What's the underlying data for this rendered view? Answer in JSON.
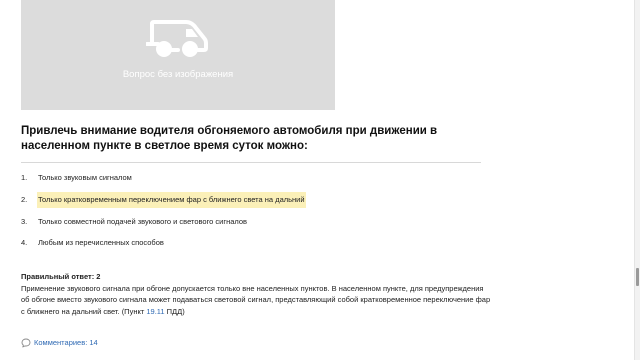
{
  "image_placeholder": {
    "icon": "car-icon",
    "text": "Вопрос без изображения"
  },
  "question": {
    "text": "Привлечь внимание водителя обгоняемого автомобиля при движении в населенном пункте в светлое время суток можно:"
  },
  "answers": [
    {
      "number": "1.",
      "text": "Только звуковым сигналом",
      "correct": false
    },
    {
      "number": "2.",
      "text": "Только кратковременным переключением фар с ближнего света на дальний",
      "correct": true
    },
    {
      "number": "3.",
      "text": "Только совместной подачей звукового и светового сигналов",
      "correct": false
    },
    {
      "number": "4.",
      "text": "Любым из перечисленных способов",
      "correct": false
    }
  ],
  "explanation": {
    "title": "Правильный ответ: 2",
    "text_before_link": "Применение звукового сигнала при обгоне допускается только вне населенных пунктов. В населенном пункте, для предупреждения об обгоне вместо звукового сигнала может подаваться световой сигнал, представляющий собой кратковременное переключение фар с ближнего на дальний свет. (Пункт ",
    "link_text": "19.11",
    "text_after_link": " ПДД)"
  },
  "comments": {
    "icon": "comment-bubble-icon",
    "label": "Комментариев: 14"
  },
  "colors": {
    "highlight": "#fbf0b8",
    "link": "#2f6ab4",
    "placeholder_bg": "#dcdcdc"
  }
}
